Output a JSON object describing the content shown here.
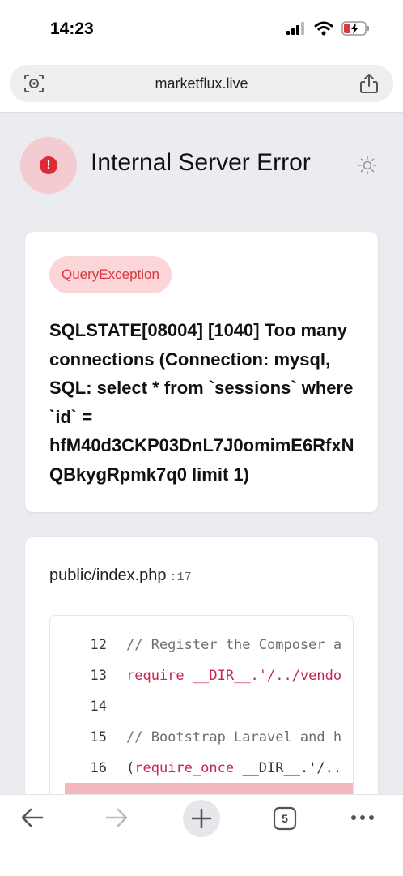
{
  "status": {
    "time": "14:23"
  },
  "browser": {
    "url": "marketflux.live",
    "tabs_count": "5"
  },
  "error": {
    "title": "Internal Server Error",
    "exception": "QueryException",
    "message": "SQLSTATE[08004] [1040] Too many connections (Connection: mysql, SQL: select * from `sessions` where `id` = hfM40d3CKP03DnL7J0omimE6RfxNQBkygRpmk7q0 limit 1)"
  },
  "trace": {
    "file": "public/index.php",
    "line": ":17",
    "lines": [
      {
        "no": "12",
        "code": "// Register the Composer a"
      },
      {
        "no": "13",
        "kw": "require",
        "rest": " __DIR__.'/../vendo"
      },
      {
        "no": "14",
        "code": ""
      },
      {
        "no": "15",
        "code": "// Bootstrap Laravel and h"
      },
      {
        "no": "16",
        "pre": "(",
        "kw": "require_once",
        "rest": " __DIR__.'/.."
      }
    ]
  },
  "colors": {
    "accent_red": "#dc2a36",
    "badge_bg": "#fbd5d7",
    "highlight_line": "#f5b8bd"
  }
}
